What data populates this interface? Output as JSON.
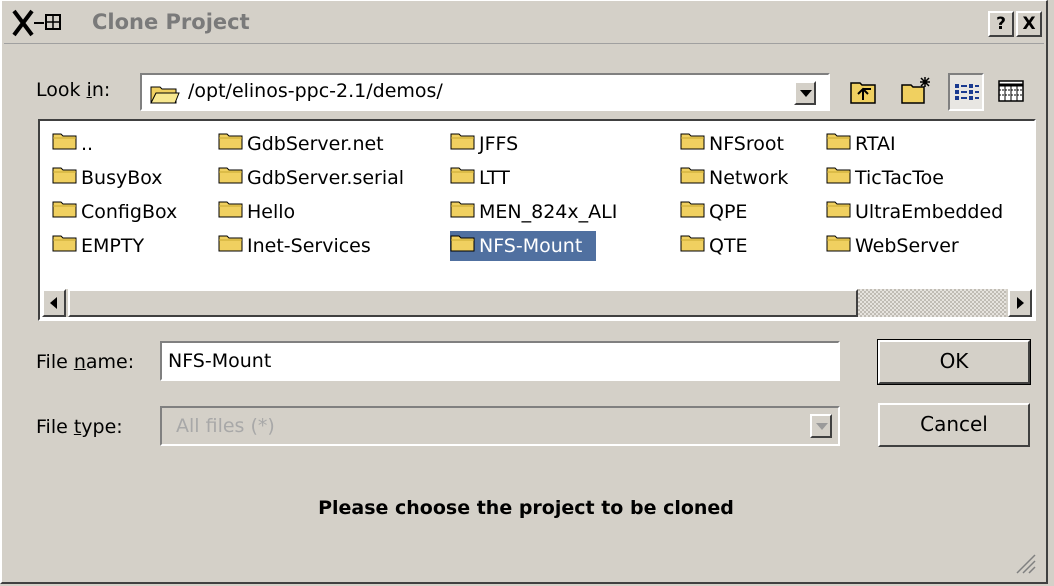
{
  "window": {
    "title": "Clone Project",
    "help_label": "?",
    "close_label": "X"
  },
  "look_in": {
    "label_pre": "Look ",
    "label_ul": "i",
    "label_post": "n:",
    "path": "/opt/elinos-ppc-2.1/demos/"
  },
  "toolbar": {
    "icons": [
      "parent-directory-icon",
      "new-folder-icon",
      "list-view-icon",
      "detail-view-icon"
    ]
  },
  "files": [
    {
      "name": ".."
    },
    {
      "name": "BusyBox"
    },
    {
      "name": "ConfigBox"
    },
    {
      "name": "EMPTY"
    },
    {
      "name": "GdbServer.net"
    },
    {
      "name": "GdbServer.serial"
    },
    {
      "name": "Hello"
    },
    {
      "name": "Inet-Services"
    },
    {
      "name": "JFFS"
    },
    {
      "name": "LTT"
    },
    {
      "name": "MEN_824x_ALI"
    },
    {
      "name": "NFS-Mount",
      "selected": true
    },
    {
      "name": "NFSroot"
    },
    {
      "name": "Network"
    },
    {
      "name": "QPE"
    },
    {
      "name": "QTE"
    },
    {
      "name": "RTAI"
    },
    {
      "name": "TicTacToe"
    },
    {
      "name": "UltraEmbedded"
    },
    {
      "name": "WebServer"
    }
  ],
  "file_name": {
    "label_pre": "File ",
    "label_ul": "n",
    "label_post": "ame:",
    "value": "NFS-Mount"
  },
  "file_type": {
    "label_pre": "File ",
    "label_ul": "t",
    "label_post": "ype:",
    "value": "All files (*)"
  },
  "buttons": {
    "ok": "OK",
    "cancel": "Cancel"
  },
  "message": "Please choose the project to be cloned",
  "colors": {
    "selection": "#5070a0",
    "folder": "#f0d060",
    "dialog_bg": "#d4d0c8"
  }
}
